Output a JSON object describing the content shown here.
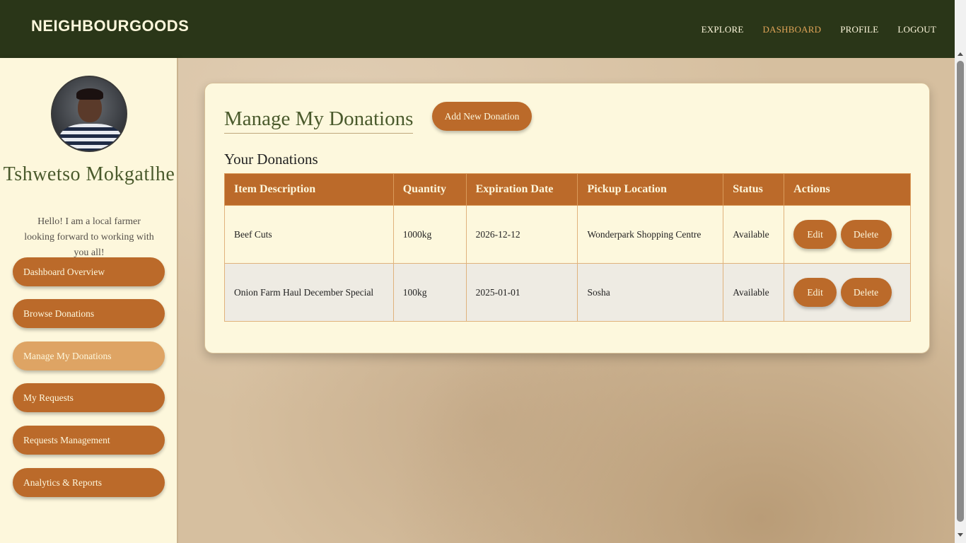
{
  "header": {
    "brand": "NEIGHBOURGOODS",
    "nav": [
      {
        "label": "EXPLORE",
        "active": false
      },
      {
        "label": "DASHBOARD",
        "active": true
      },
      {
        "label": "PROFILE",
        "active": false
      },
      {
        "label": "LOGOUT",
        "active": false
      }
    ]
  },
  "sidebar": {
    "profile": {
      "name": "Tshwetso Mokgatlhe",
      "bio": "Hello! I am a local farmer looking forward to working with you all!"
    },
    "items": [
      {
        "label": "Dashboard Overview",
        "active": false
      },
      {
        "label": "Browse Donations",
        "active": false
      },
      {
        "label": "Manage My Donations",
        "active": true
      },
      {
        "label": "My Requests",
        "active": false
      },
      {
        "label": "Requests Management",
        "active": false
      },
      {
        "label": "Analytics & Reports",
        "active": false
      }
    ]
  },
  "main": {
    "title": "Manage My Donations",
    "add_button": "Add New Donation",
    "section_title": "Your Donations",
    "table": {
      "headers": [
        "Item Description",
        "Quantity",
        "Expiration Date",
        "Pickup Location",
        "Status",
        "Actions"
      ],
      "rows": [
        {
          "description": "Beef Cuts",
          "quantity": "1000kg",
          "expiration": "2026-12-12",
          "location": "Wonderpark Shopping Centre",
          "status": "Available",
          "edit": "Edit",
          "delete": "Delete"
        },
        {
          "description": "Onion Farm Haul December Special",
          "quantity": "100kg",
          "expiration": "2025-01-01",
          "location": "Sosha",
          "status": "Available",
          "edit": "Edit",
          "delete": "Delete"
        }
      ]
    }
  },
  "colors": {
    "header_bg": "#2a3618",
    "accent": "#bb6a2a",
    "accent_active": "#dea464",
    "nav_active": "#e0a458",
    "panel_bg": "#fdf8dd",
    "title_green": "#4a5a2c"
  }
}
